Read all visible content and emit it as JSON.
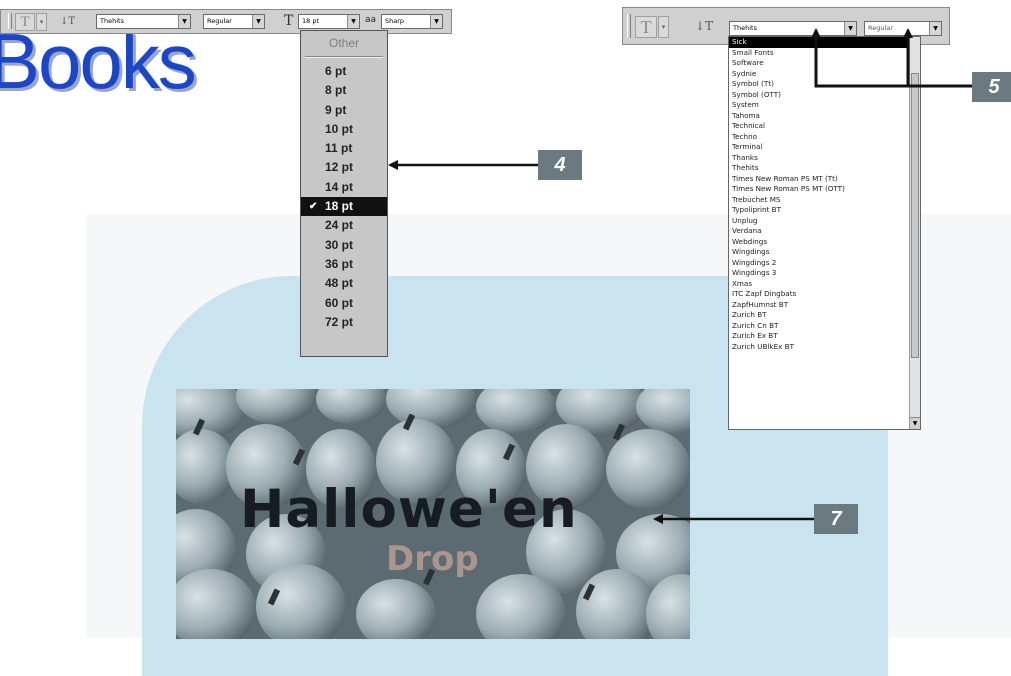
{
  "book_title": "Books",
  "left_toolbar": {
    "font_family": "Thehits",
    "font_style": "Regular",
    "font_size": "18 pt",
    "antialias_label": "aa",
    "antialias": "Sharp"
  },
  "size_menu": {
    "other_label": "Other",
    "checkmark": "✔",
    "items": [
      "6 pt",
      "8 pt",
      "9 pt",
      "10 pt",
      "11 pt",
      "12 pt",
      "14 pt",
      "18 pt",
      "24 pt",
      "30 pt",
      "36 pt",
      "48 pt",
      "60 pt",
      "72 pt"
    ],
    "selected_index": 7
  },
  "right_toolbar": {
    "font_family": "Thehits",
    "font_style": "Regular"
  },
  "font_menu": {
    "items": [
      "Sick",
      "Small Fonts",
      "Software",
      "Sydnie",
      "Symbol (Tt)",
      "Symbol (OTT)",
      "System",
      "Tahoma",
      "Technical",
      "Techno",
      "Terminal",
      "Thanks",
      "Thehits",
      "Times New Roman PS MT (Tt)",
      "Times New Roman PS MT (OTT)",
      "Trebuchet MS",
      "Typoliprint BT",
      "Unplug",
      "Verdana",
      "Webdings",
      "Wingdings",
      "Wingdings 2",
      "Wingdings 3",
      "Xmas",
      "ITC Zapf Dingbats",
      "ZapfHumnst BT",
      "Zurich BT",
      "Zurich Cn BT",
      "Zurich Ex BT",
      "Zurich UBlkEx BT"
    ],
    "selected_index": 0
  },
  "photo": {
    "headline": "Hallowe'en",
    "watermark": "Drop"
  },
  "callouts": {
    "c4": "4",
    "c5": "5",
    "c7": "7"
  },
  "icons": {
    "type_tool": "type-tool-icon",
    "orientation": "text-orientation-icon",
    "font_size": "font-size-icon",
    "dropdown": "dropdown-arrow-icon",
    "checkmark": "checkmark-icon"
  },
  "colors": {
    "book_title": "#1a47c8",
    "callout": "#6b7a80",
    "selection": "#000000",
    "background_shape": "#c9e4ee"
  }
}
